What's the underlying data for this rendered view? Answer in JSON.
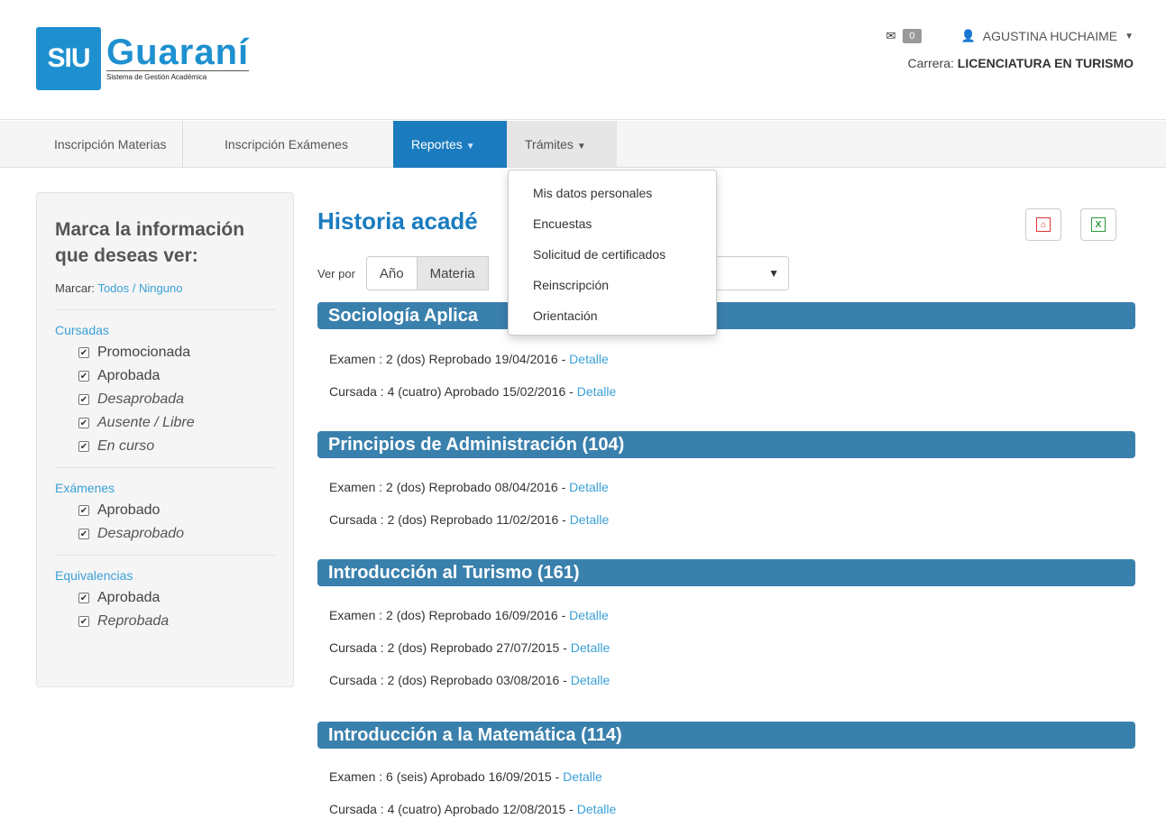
{
  "logo": {
    "mark": "SIU",
    "name": "Guaraní",
    "sub": "Sistema de Gestión Académica"
  },
  "header": {
    "mail_count": "0",
    "user_name": "AGUSTINA HUCHAIME",
    "carrera_label": "Carrera:",
    "carrera_value": "LICENCIATURA EN TURISMO"
  },
  "nav": {
    "items": [
      {
        "label": "Inscripción Materias"
      },
      {
        "label": "Inscripción Exámenes"
      },
      {
        "label": "Reportes"
      },
      {
        "label": "Trámites"
      }
    ]
  },
  "dropdown": {
    "items": [
      {
        "label": "Mis datos personales"
      },
      {
        "label": "Encuestas"
      },
      {
        "label": "Solicitud de certificados"
      },
      {
        "label": "Reinscripción"
      },
      {
        "label": "Orientación"
      }
    ]
  },
  "sidebar": {
    "title_1": "Marca la información",
    "title_2": "que deseas ver:",
    "mark_label": "Marcar:",
    "all": "Todos",
    "sep": "/",
    "none": "Ninguno",
    "sections": [
      {
        "heading": "Cursadas",
        "items": [
          "Promocionada",
          "Aprobada",
          "Desaprobada",
          "Ausente / Libre",
          "En curso"
        ]
      },
      {
        "heading": "Exámenes",
        "items": [
          "Aprobado",
          "Desaprobado"
        ]
      },
      {
        "heading": "Equivalencias",
        "items": [
          "Aprobada",
          "Reprobada"
        ]
      }
    ]
  },
  "main": {
    "title": "Historia acadé",
    "ver_por": "Ver por",
    "seg_anio": "Año",
    "seg_materia": "Materia",
    "detail_link": "Detalle",
    "subjects": [
      {
        "name": "Sociología Aplica",
        "lines": [
          "Examen : 2 (dos) Reprobado 19/04/2016 - ",
          "Cursada : 4 (cuatro) Aprobado 15/02/2016 - "
        ]
      },
      {
        "name": "Principios de Administración (104)",
        "lines": [
          "Examen : 2 (dos) Reprobado 08/04/2016 - ",
          "Cursada : 2 (dos) Reprobado 11/02/2016 - "
        ]
      },
      {
        "name": "Introducción al Turismo (161)",
        "lines": [
          "Examen : 2 (dos) Reprobado 16/09/2016 - ",
          "Cursada : 2 (dos) Reprobado 27/07/2015 - ",
          "Cursada : 2 (dos) Reprobado 03/08/2016 - "
        ]
      },
      {
        "name": "Introducción a la Matemática (114)",
        "lines": [
          "Examen : 6 (seis) Aprobado 16/09/2015 - ",
          "Cursada : 4 (cuatro) Aprobado 12/08/2015 - "
        ]
      }
    ]
  }
}
